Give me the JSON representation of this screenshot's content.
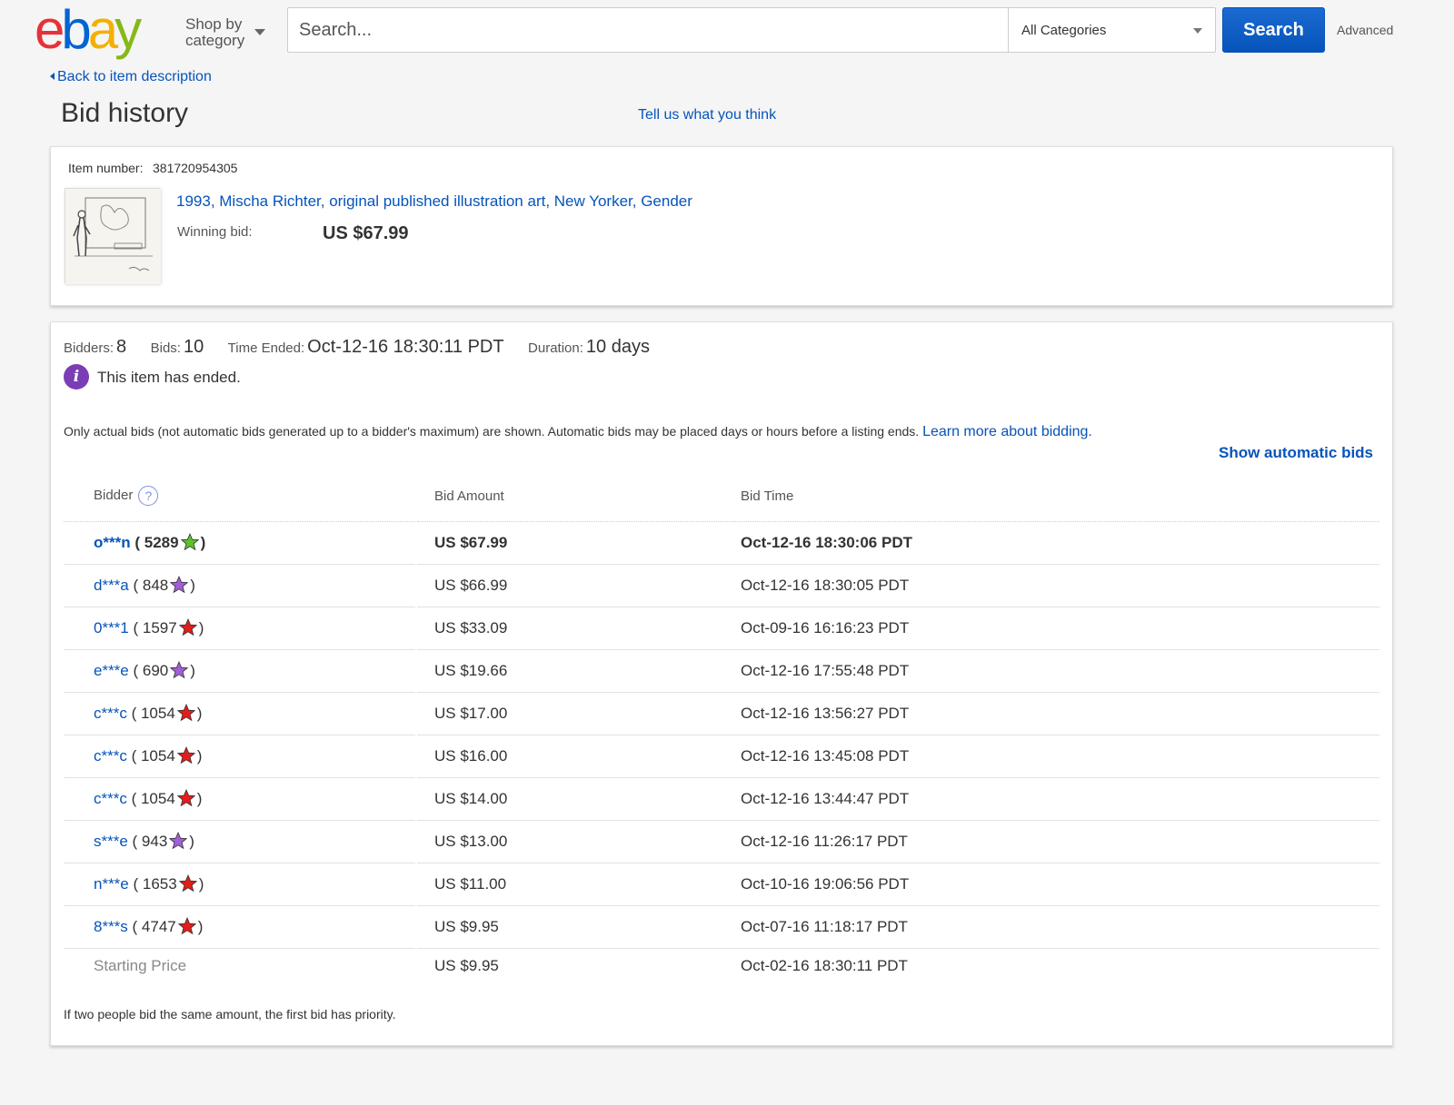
{
  "header": {
    "logo": {
      "e": "e",
      "b": "b",
      "a": "a",
      "y": "y"
    },
    "shop_by_line1": "Shop by",
    "shop_by_line2": "category",
    "search_placeholder": "Search...",
    "category_selected": "All Categories",
    "search_button": "Search",
    "advanced_link": "Advanced",
    "logo_colors": {
      "e": "#e53238",
      "b": "#0064d2",
      "a": "#f5af02",
      "y": "#86b817"
    }
  },
  "nav": {
    "back_link": "Back to item description",
    "page_title": "Bid history",
    "feedback_link": "Tell us what you think"
  },
  "item": {
    "number_label": "Item number:",
    "number": "381720954305",
    "title": "1993, Mischa Richter, original published illustration art, New Yorker, Gender",
    "winning_label": "Winning bid:",
    "winning_bid": "US $67.99"
  },
  "summary": {
    "bidders_label": "Bidders:",
    "bidders": "8",
    "bids_label": "Bids:",
    "bids": "10",
    "time_ended_label": "Time Ended:",
    "time_ended": "Oct-12-16 18:30:11 PDT",
    "duration_label": "Duration:",
    "duration": "10 days",
    "ended_message": "This item has ended.",
    "note": "Only actual bids (not automatic bids generated up to a bidder's maximum) are shown. Automatic bids may be placed days or hours before a listing ends.",
    "learn_more": "Learn more about bidding.",
    "show_automatic": "Show automatic bids"
  },
  "table": {
    "headers": {
      "bidder": "Bidder",
      "amount": "Bid Amount",
      "time": "Bid Time"
    },
    "rows": [
      {
        "bidder": "o***n",
        "feedback": "( 5289",
        "close": ")",
        "star": "green-star-icon",
        "amount": "US $67.99",
        "time": "Oct-12-16 18:30:06 PDT"
      },
      {
        "bidder": "d***a",
        "feedback": "( 848",
        "close": ")",
        "star": "purple-star-icon",
        "amount": "US $66.99",
        "time": "Oct-12-16 18:30:05 PDT"
      },
      {
        "bidder": "0***1",
        "feedback": "( 1597",
        "close": ")",
        "star": "red-star-icon",
        "amount": "US $33.09",
        "time": "Oct-09-16 16:16:23 PDT"
      },
      {
        "bidder": "e***e",
        "feedback": "( 690",
        "close": ")",
        "star": "purple-star-icon",
        "amount": "US $19.66",
        "time": "Oct-12-16 17:55:48 PDT"
      },
      {
        "bidder": "c***c",
        "feedback": "( 1054",
        "close": ")",
        "star": "red-star-icon",
        "amount": "US $17.00",
        "time": "Oct-12-16 13:56:27 PDT"
      },
      {
        "bidder": "c***c",
        "feedback": "( 1054",
        "close": ")",
        "star": "red-star-icon",
        "amount": "US $16.00",
        "time": "Oct-12-16 13:45:08 PDT"
      },
      {
        "bidder": "c***c",
        "feedback": "( 1054",
        "close": ")",
        "star": "red-star-icon",
        "amount": "US $14.00",
        "time": "Oct-12-16 13:44:47 PDT"
      },
      {
        "bidder": "s***e",
        "feedback": "( 943",
        "close": ")",
        "star": "purple-star-icon",
        "amount": "US $13.00",
        "time": "Oct-12-16 11:26:17 PDT"
      },
      {
        "bidder": "n***e",
        "feedback": "( 1653",
        "close": ")",
        "star": "red-star-icon",
        "amount": "US $11.00",
        "time": "Oct-10-16 19:06:56 PDT"
      },
      {
        "bidder": "8***s",
        "feedback": "( 4747",
        "close": ")",
        "star": "red-star-icon",
        "amount": "US $9.95",
        "time": "Oct-07-16 11:18:17 PDT"
      }
    ],
    "starting": {
      "label": "Starting Price",
      "amount": "US $9.95",
      "time": "Oct-02-16 18:30:11 PDT"
    }
  },
  "footnote": "If two people bid the same amount, the first bid has priority.",
  "star_colors": {
    "green": "#5cc12b",
    "purple": "#a15fd6",
    "red": "#e41c1c"
  }
}
